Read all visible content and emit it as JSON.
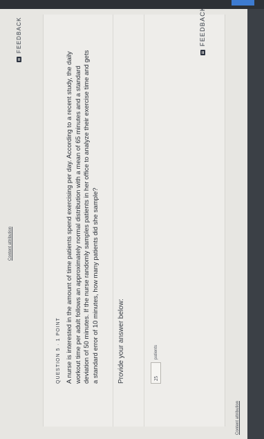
{
  "header": {
    "content_attribution": "Content attribution",
    "feedback_label": "FEEDBACK"
  },
  "question": {
    "header": "QUESTION 5 · 1 POINT",
    "text": "A nurse is interested in the amount of time patients spend exercising per day. According to a recent study, the daily workout time per adult follows an approximately normal distribution with a mean of 65 minutes and a standard deviation of 50 minutes. If the nurse randomly samples patients in her office to analyze their exercise time and gets a standard error of 10 minutes, how many patients did she sample?",
    "prompt": "Provide your answer below:"
  },
  "answer": {
    "value": "25",
    "unit": "patients"
  },
  "footer": {
    "content_attribution": "Content attribution",
    "feedback_label": "FEEDBACK"
  },
  "colors": {
    "page_bg": "#e7e6e2",
    "card_bg": "#eeedea",
    "accent_blue": "#3d7bd0"
  },
  "icons": {
    "feedback": "feedback-icon"
  }
}
